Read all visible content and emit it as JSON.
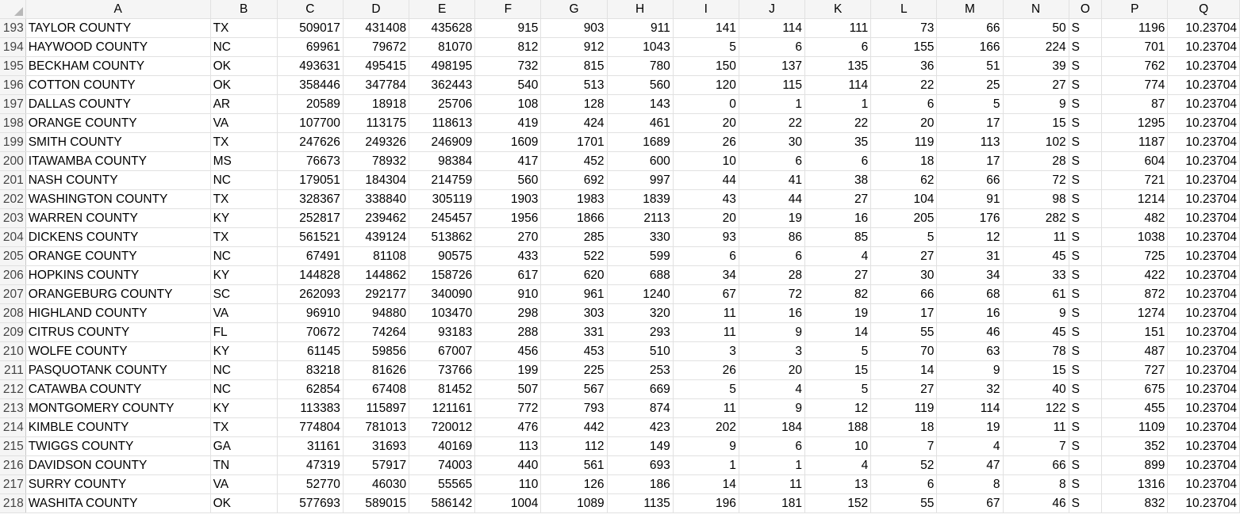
{
  "sheet": {
    "columns": [
      "A",
      "B",
      "C",
      "D",
      "E",
      "F",
      "G",
      "H",
      "I",
      "J",
      "K",
      "L",
      "M",
      "N",
      "O",
      "P",
      "Q"
    ],
    "rows": [
      {
        "n": "193",
        "cells": [
          "TAYLOR COUNTY",
          "TX",
          "509017",
          "431408",
          "435628",
          "915",
          "903",
          "911",
          "141",
          "114",
          "111",
          "73",
          "66",
          "50",
          "S",
          "1196",
          "10.23704"
        ]
      },
      {
        "n": "194",
        "cells": [
          "HAYWOOD COUNTY",
          "NC",
          "69961",
          "79672",
          "81070",
          "812",
          "912",
          "1043",
          "5",
          "6",
          "6",
          "155",
          "166",
          "224",
          "S",
          "701",
          "10.23704"
        ]
      },
      {
        "n": "195",
        "cells": [
          "BECKHAM COUNTY",
          "OK",
          "493631",
          "495415",
          "498195",
          "732",
          "815",
          "780",
          "150",
          "137",
          "135",
          "36",
          "51",
          "39",
          "S",
          "762",
          "10.23704"
        ]
      },
      {
        "n": "196",
        "cells": [
          "COTTON COUNTY",
          "OK",
          "358446",
          "347784",
          "362443",
          "540",
          "513",
          "560",
          "120",
          "115",
          "114",
          "22",
          "25",
          "27",
          "S",
          "774",
          "10.23704"
        ]
      },
      {
        "n": "197",
        "cells": [
          "DALLAS COUNTY",
          "AR",
          "20589",
          "18918",
          "25706",
          "108",
          "128",
          "143",
          "0",
          "1",
          "1",
          "6",
          "5",
          "9",
          "S",
          "87",
          "10.23704"
        ]
      },
      {
        "n": "198",
        "cells": [
          "ORANGE COUNTY",
          "VA",
          "107700",
          "113175",
          "118613",
          "419",
          "424",
          "461",
          "20",
          "22",
          "22",
          "20",
          "17",
          "15",
          "S",
          "1295",
          "10.23704"
        ]
      },
      {
        "n": "199",
        "cells": [
          "SMITH COUNTY",
          "TX",
          "247626",
          "249326",
          "246909",
          "1609",
          "1701",
          "1689",
          "26",
          "30",
          "35",
          "119",
          "113",
          "102",
          "S",
          "1187",
          "10.23704"
        ]
      },
      {
        "n": "200",
        "cells": [
          "ITAWAMBA COUNTY",
          "MS",
          "76673",
          "78932",
          "98384",
          "417",
          "452",
          "600",
          "10",
          "6",
          "6",
          "18",
          "17",
          "28",
          "S",
          "604",
          "10.23704"
        ]
      },
      {
        "n": "201",
        "cells": [
          "NASH COUNTY",
          "NC",
          "179051",
          "184304",
          "214759",
          "560",
          "692",
          "997",
          "44",
          "41",
          "38",
          "62",
          "66",
          "72",
          "S",
          "721",
          "10.23704"
        ]
      },
      {
        "n": "202",
        "cells": [
          "WASHINGTON COUNTY",
          "TX",
          "328367",
          "338840",
          "305119",
          "1903",
          "1983",
          "1839",
          "43",
          "44",
          "27",
          "104",
          "91",
          "98",
          "S",
          "1214",
          "10.23704"
        ]
      },
      {
        "n": "203",
        "cells": [
          "WARREN COUNTY",
          "KY",
          "252817",
          "239462",
          "245457",
          "1956",
          "1866",
          "2113",
          "20",
          "19",
          "16",
          "205",
          "176",
          "282",
          "S",
          "482",
          "10.23704"
        ]
      },
      {
        "n": "204",
        "cells": [
          "DICKENS COUNTY",
          "TX",
          "561521",
          "439124",
          "513862",
          "270",
          "285",
          "330",
          "93",
          "86",
          "85",
          "5",
          "12",
          "11",
          "S",
          "1038",
          "10.23704"
        ]
      },
      {
        "n": "205",
        "cells": [
          "ORANGE COUNTY",
          "NC",
          "67491",
          "81108",
          "90575",
          "433",
          "522",
          "599",
          "6",
          "6",
          "4",
          "27",
          "31",
          "45",
          "S",
          "725",
          "10.23704"
        ]
      },
      {
        "n": "206",
        "cells": [
          "HOPKINS COUNTY",
          "KY",
          "144828",
          "144862",
          "158726",
          "617",
          "620",
          "688",
          "34",
          "28",
          "27",
          "30",
          "34",
          "33",
          "S",
          "422",
          "10.23704"
        ]
      },
      {
        "n": "207",
        "cells": [
          "ORANGEBURG COUNTY",
          "SC",
          "262093",
          "292177",
          "340090",
          "910",
          "961",
          "1240",
          "67",
          "72",
          "82",
          "66",
          "68",
          "61",
          "S",
          "872",
          "10.23704"
        ]
      },
      {
        "n": "208",
        "cells": [
          "HIGHLAND COUNTY",
          "VA",
          "96910",
          "94880",
          "103470",
          "298",
          "303",
          "320",
          "11",
          "16",
          "19",
          "17",
          "16",
          "9",
          "S",
          "1274",
          "10.23704"
        ]
      },
      {
        "n": "209",
        "cells": [
          "CITRUS COUNTY",
          "FL",
          "70672",
          "74264",
          "93183",
          "288",
          "331",
          "293",
          "11",
          "9",
          "14",
          "55",
          "46",
          "45",
          "S",
          "151",
          "10.23704"
        ]
      },
      {
        "n": "210",
        "cells": [
          "WOLFE COUNTY",
          "KY",
          "61145",
          "59856",
          "67007",
          "456",
          "453",
          "510",
          "3",
          "3",
          "5",
          "70",
          "63",
          "78",
          "S",
          "487",
          "10.23704"
        ]
      },
      {
        "n": "211",
        "cells": [
          "PASQUOTANK COUNTY",
          "NC",
          "83218",
          "81626",
          "73766",
          "199",
          "225",
          "253",
          "26",
          "20",
          "15",
          "14",
          "9",
          "15",
          "S",
          "727",
          "10.23704"
        ]
      },
      {
        "n": "212",
        "cells": [
          "CATAWBA COUNTY",
          "NC",
          "62854",
          "67408",
          "81452",
          "507",
          "567",
          "669",
          "5",
          "4",
          "5",
          "27",
          "32",
          "40",
          "S",
          "675",
          "10.23704"
        ]
      },
      {
        "n": "213",
        "cells": [
          "MONTGOMERY COUNTY",
          "KY",
          "113383",
          "115897",
          "121161",
          "772",
          "793",
          "874",
          "11",
          "9",
          "12",
          "119",
          "114",
          "122",
          "S",
          "455",
          "10.23704"
        ]
      },
      {
        "n": "214",
        "cells": [
          "KIMBLE COUNTY",
          "TX",
          "774804",
          "781013",
          "720012",
          "476",
          "442",
          "423",
          "202",
          "184",
          "188",
          "18",
          "19",
          "11",
          "S",
          "1109",
          "10.23704"
        ]
      },
      {
        "n": "215",
        "cells": [
          "TWIGGS COUNTY",
          "GA",
          "31161",
          "31693",
          "40169",
          "113",
          "112",
          "149",
          "9",
          "6",
          "10",
          "7",
          "4",
          "7",
          "S",
          "352",
          "10.23704"
        ]
      },
      {
        "n": "216",
        "cells": [
          "DAVIDSON COUNTY",
          "TN",
          "47319",
          "57917",
          "74003",
          "440",
          "561",
          "693",
          "1",
          "1",
          "4",
          "52",
          "47",
          "66",
          "S",
          "899",
          "10.23704"
        ]
      },
      {
        "n": "217",
        "cells": [
          "SURRY COUNTY",
          "VA",
          "52770",
          "46030",
          "55565",
          "110",
          "126",
          "186",
          "14",
          "11",
          "13",
          "6",
          "8",
          "8",
          "S",
          "1316",
          "10.23704"
        ]
      },
      {
        "n": "218",
        "cells": [
          "WASHITA COUNTY",
          "OK",
          "577693",
          "589015",
          "586142",
          "1004",
          "1089",
          "1135",
          "196",
          "181",
          "152",
          "55",
          "67",
          "46",
          "S",
          "832",
          "10.23704"
        ]
      }
    ]
  }
}
